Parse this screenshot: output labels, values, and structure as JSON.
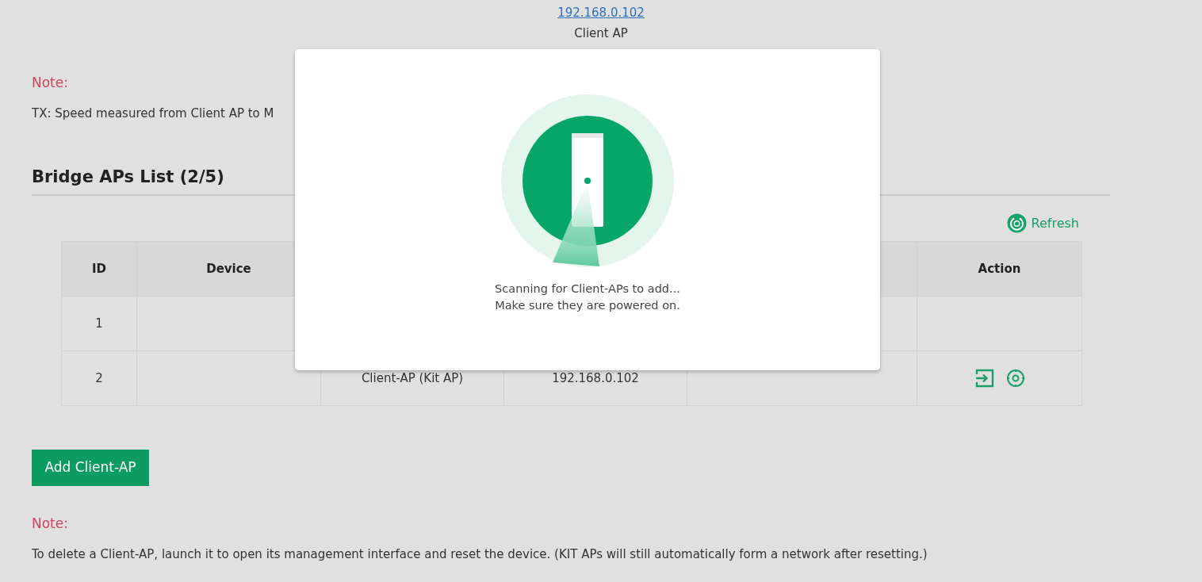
{
  "device_link": {
    "address": "192.168.0.102",
    "label": "Client AP"
  },
  "note_top": {
    "title": "Note:",
    "text": "TX: Speed measured from Client AP to M"
  },
  "list": {
    "title": "Bridge APs List (2/5)",
    "refresh": "Refresh"
  },
  "table": {
    "columns": [
      "ID",
      "Device",
      null,
      null,
      null,
      "Action"
    ],
    "rows": [
      {
        "cells": [
          "1",
          null,
          null,
          null,
          null,
          null
        ],
        "actions": []
      },
      {
        "cells": [
          "2",
          null,
          "Client-AP (Kit AP)",
          "192.168.0.102",
          null,
          null
        ],
        "actions": [
          {
            "kind": "launch"
          },
          {
            "kind": "settings"
          }
        ]
      }
    ]
  },
  "add_button": "Add Client-AP",
  "note_bottom": {
    "title": "Note:",
    "text": "To delete a Client-AP, launch it to open its management interface and reset the device. (KIT APs will still automatically form a network after resetting.)"
  },
  "dialog": {
    "lines": [
      "Scanning for Client-APs to add...",
      "Make sure they are powered on."
    ]
  }
}
